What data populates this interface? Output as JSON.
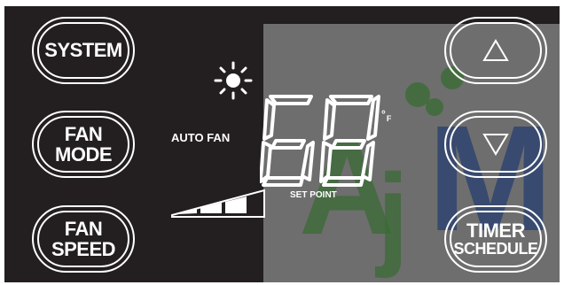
{
  "buttons": {
    "system": {
      "label": "SYSTEM"
    },
    "fan_mode": {
      "line1": "FAN",
      "line2": "MODE"
    },
    "fan_speed": {
      "line1": "FAN",
      "line2": "SPEED"
    },
    "timer_schedule": {
      "line1": "TIMER",
      "line2": "SCHEDULE"
    }
  },
  "display": {
    "mode_icon": "sun-icon",
    "fan_mode_text": "AUTO FAN",
    "temperature": "68",
    "unit_degree": "°",
    "unit_letter": "F",
    "set_point_label": "SET POINT",
    "fan_speed_level": 3,
    "fan_speed_max": 3
  },
  "arrows": {
    "up_icon": "triangle-up-icon",
    "down_icon": "triangle-down-icon"
  },
  "colors": {
    "panel": "#231f20",
    "segment": "#ffffff",
    "text": "#ffffff"
  }
}
